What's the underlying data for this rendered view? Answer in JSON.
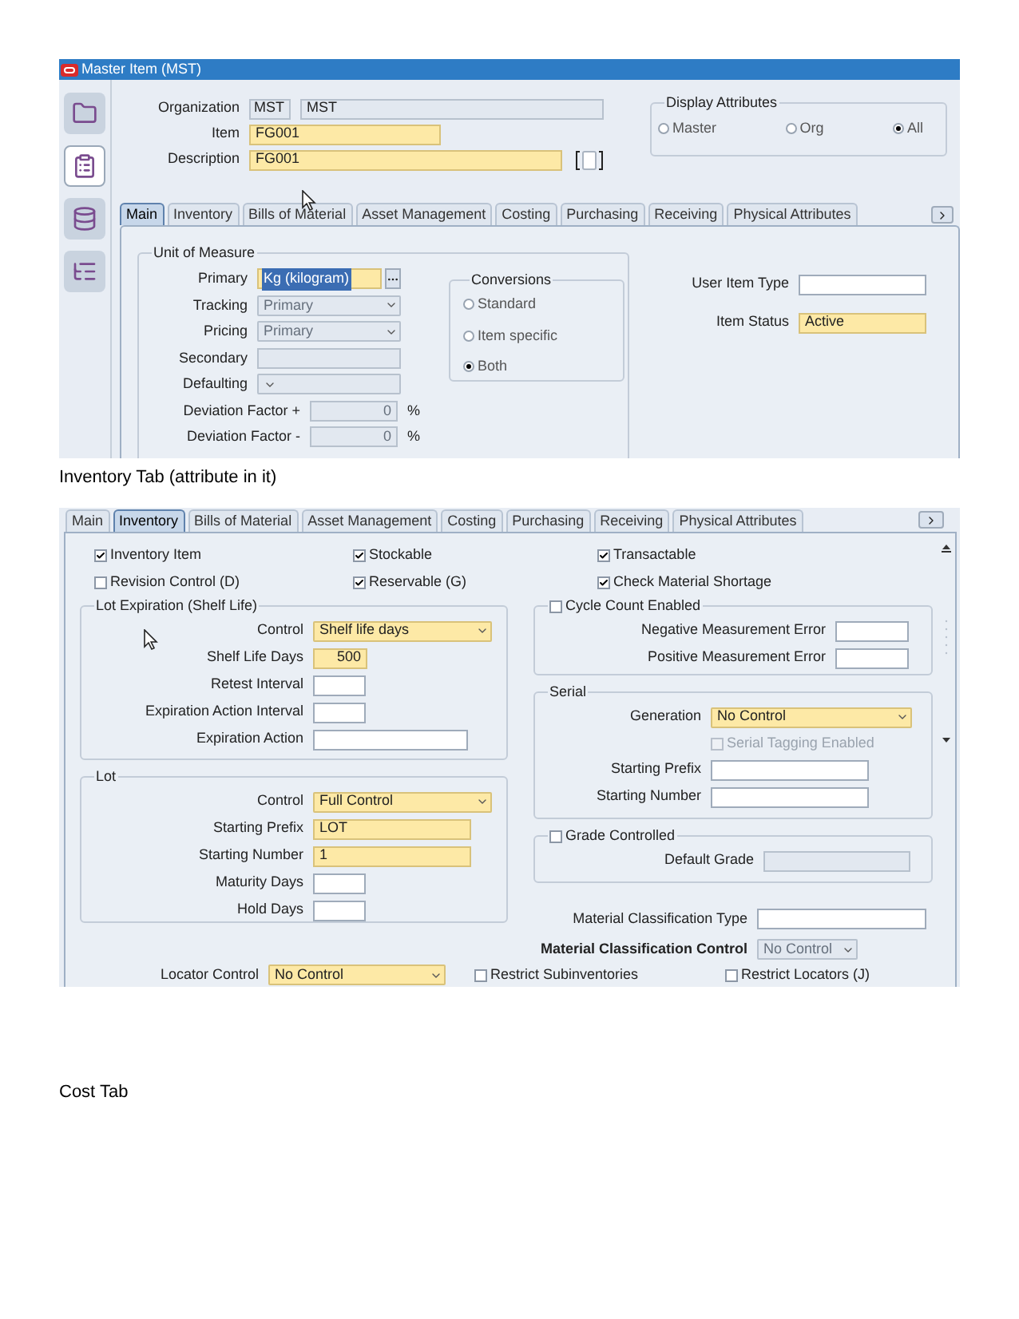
{
  "screen_1": {
    "window": {
      "title": "Master Item (MST)"
    },
    "header": {
      "organization": {
        "label": "Organization",
        "code": "MST",
        "name": "MST"
      },
      "item": {
        "label": "Item",
        "value": "FG001",
        "kind": "text",
        "required": true,
        "disabled": false
      },
      "description": {
        "label": "Description",
        "value": "FG001",
        "kind": "text",
        "required": true,
        "disabled": false
      },
      "display_attributes": {
        "title": "Display Attributes",
        "options": [
          {
            "label": "Master",
            "selected": false
          },
          {
            "label": "Org",
            "selected": false
          },
          {
            "label": "All",
            "selected": true
          }
        ]
      }
    },
    "tabs": [
      {
        "label": "Main",
        "selected": true
      },
      {
        "label": "Inventory",
        "selected": false
      },
      {
        "label": "Bills of Material",
        "selected": false
      },
      {
        "label": "Asset Management",
        "selected": false
      },
      {
        "label": "Costing",
        "selected": false
      },
      {
        "label": "Purchasing",
        "selected": false
      },
      {
        "label": "Receiving",
        "selected": false
      },
      {
        "label": "Physical Attributes",
        "selected": false
      }
    ],
    "unit_of_measure": {
      "title": "Unit of Measure",
      "fields": [
        {
          "label": "Primary",
          "value": "Kg (kilogram)",
          "kind": "lov",
          "required": true,
          "disabled": false,
          "text_selected": true
        },
        {
          "label": "Tracking",
          "value": "Primary",
          "kind": "select",
          "disabled": true,
          "text_selected": false
        },
        {
          "label": "Pricing",
          "value": "Primary",
          "kind": "select",
          "disabled": true,
          "text_selected": false
        },
        {
          "label": "Secondary",
          "kind": "text",
          "disabled": true,
          "text_selected": false
        },
        {
          "label": "Defaulting",
          "kind": "select",
          "disabled": true,
          "text_selected": false
        },
        {
          "label": "Deviation Factor +",
          "value": "0",
          "kind": "number",
          "unit": "%",
          "disabled": true,
          "text_selected": false
        },
        {
          "label": "Deviation Factor -",
          "value": "0",
          "kind": "number",
          "unit": "%",
          "disabled": true,
          "text_selected": false
        }
      ],
      "conversions": {
        "title": "Conversions",
        "options": [
          {
            "label": "Standard",
            "selected": false
          },
          {
            "label": "Item specific",
            "selected": false
          },
          {
            "label": "Both",
            "selected": true
          }
        ]
      }
    },
    "status_fields": [
      {
        "label": "User Item Type",
        "kind": "text",
        "required": false,
        "disabled": false
      },
      {
        "label": "Item Status",
        "value": "Active",
        "kind": "text",
        "required": true,
        "disabled": false
      }
    ]
  },
  "caption_1": "Inventory Tab (attribute in it)",
  "screen_2": {
    "tabs": [
      {
        "label": "Main",
        "selected": false
      },
      {
        "label": "Inventory",
        "selected": true
      },
      {
        "label": "Bills of Material",
        "selected": false
      },
      {
        "label": "Asset Management",
        "selected": false
      },
      {
        "label": "Costing",
        "selected": false
      },
      {
        "label": "Purchasing",
        "selected": false
      },
      {
        "label": "Receiving",
        "selected": false
      },
      {
        "label": "Physical Attributes",
        "selected": false
      }
    ],
    "checkboxes": [
      {
        "label": "Inventory Item",
        "checked": true
      },
      {
        "label": "Stockable",
        "checked": true
      },
      {
        "label": "Transactable",
        "checked": true
      },
      {
        "label": "Revision Control (D)",
        "checked": false
      },
      {
        "label": "Reservable (G)",
        "checked": true
      },
      {
        "label": "Check Material Shortage",
        "checked": true
      }
    ],
    "lot_expiration": {
      "title": "Lot Expiration (Shelf Life)",
      "fields": [
        {
          "label": "Control",
          "value": "Shelf life days",
          "kind": "select",
          "required": true,
          "disabled": false
        },
        {
          "label": "Shelf Life Days",
          "value": "500",
          "kind": "number",
          "required": true,
          "disabled": false
        },
        {
          "label": "Retest Interval",
          "kind": "text",
          "required": false,
          "disabled": false
        },
        {
          "label": "Expiration Action Interval",
          "kind": "text",
          "required": false,
          "disabled": false
        },
        {
          "label": "Expiration Action",
          "kind": "text",
          "required": false,
          "disabled": false
        }
      ]
    },
    "lot": {
      "title": "Lot",
      "fields": [
        {
          "label": "Control",
          "value": "Full Control",
          "kind": "select",
          "required": true,
          "disabled": false
        },
        {
          "label": "Starting Prefix",
          "value": "LOT",
          "kind": "text",
          "required": true,
          "disabled": false
        },
        {
          "label": "Starting Number",
          "value": "1",
          "kind": "text",
          "required": true,
          "disabled": false
        },
        {
          "label": "Maturity Days",
          "kind": "text",
          "required": false,
          "disabled": false
        },
        {
          "label": "Hold Days",
          "kind": "text",
          "required": false,
          "disabled": false
        }
      ]
    },
    "cycle_count": {
      "label": "Cycle Count Enabled",
      "checked": false,
      "fields": [
        {
          "label": "Negative Measurement Error",
          "kind": "text",
          "required": false,
          "disabled": false
        },
        {
          "label": "Positive Measurement Error",
          "kind": "text",
          "required": false,
          "disabled": false
        }
      ]
    },
    "serial": {
      "title": "Serial",
      "generation": {
        "label": "Generation",
        "value": "No Control",
        "kind": "select",
        "required": true,
        "disabled": false
      },
      "tagging": {
        "label": "Serial Tagging Enabled",
        "checked": false,
        "disabled": true
      },
      "fields": [
        {
          "label": "Starting Prefix",
          "kind": "text",
          "required": false,
          "disabled": false
        },
        {
          "label": "Starting Number",
          "kind": "text",
          "required": false,
          "disabled": false
        }
      ]
    },
    "grade": {
      "label": "Grade Controlled",
      "checked": false,
      "fields": [
        {
          "label": "Default Grade",
          "kind": "text",
          "disabled": true
        }
      ]
    },
    "material_classification_type": {
      "label": "Material Classification Type",
      "kind": "text",
      "required": false,
      "disabled": false
    },
    "material_classification_control": {
      "label": "Material Classification Control",
      "value": "No Control",
      "kind": "select",
      "disabled": true
    },
    "locator_control": {
      "label": "Locator Control",
      "value": "No Control",
      "kind": "select",
      "required": true,
      "disabled": false
    },
    "restrictions": [
      {
        "label": "Restrict Subinventories",
        "checked": false
      },
      {
        "label": "Restrict Locators (J)",
        "checked": false
      }
    ]
  },
  "caption_2": "Cost Tab"
}
